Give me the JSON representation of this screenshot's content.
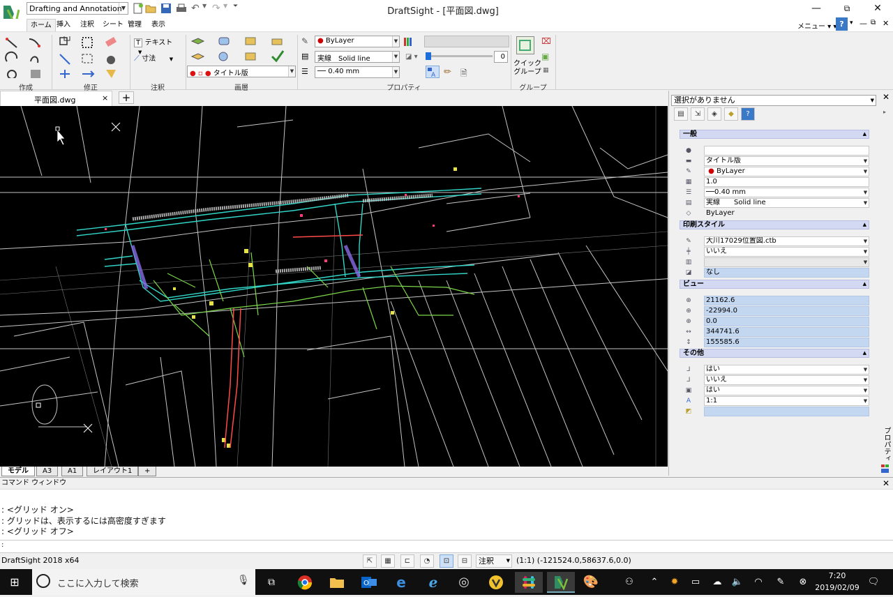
{
  "app": {
    "title": "DraftSight - [平面図.dwg]",
    "workspace": "Drafting and Annotation",
    "menu_label": "メニュー"
  },
  "menu_tabs": [
    "ホーム",
    "挿入",
    "注釈",
    "シート",
    "管理",
    "表示"
  ],
  "ribbon": {
    "groups": [
      "作成",
      "修正",
      "注釈",
      "画層",
      "プロパティ",
      "グループ"
    ],
    "text_label": "テキスト",
    "dim_label": "寸法",
    "layer_value": "タイトル版",
    "color_value": "ByLayer",
    "linetype_value": "実線　Solid line",
    "lineweight_value": "── 0.40 mm",
    "transparency_value": "0",
    "quick_group": "クイック\nグループ"
  },
  "doc_tab": {
    "name": "平面図.dwg",
    "close": "×",
    "add": "+"
  },
  "layout_tabs": [
    "モデル",
    "A3",
    "A1",
    "レイアウト1",
    "+"
  ],
  "properties": {
    "selection": "選択がありません",
    "sections": {
      "general": {
        "title": "一般",
        "rows": [
          "",
          "タイトル版",
          "ByLayer",
          "1.0",
          "──0.40 mm",
          "実線　　Solid line",
          "ByLayer"
        ]
      },
      "print": {
        "title": "印刷スタイル",
        "rows": [
          "大川17029位置図.ctb",
          "いいえ",
          "",
          "なし"
        ]
      },
      "view": {
        "title": "ビュー",
        "rows": [
          "21162.6",
          "-22994.0",
          "0.0",
          "344741.6",
          "155585.6"
        ]
      },
      "misc": {
        "title": "その他",
        "rows": [
          "はい",
          "いいえ",
          "はい",
          "1:1",
          ""
        ]
      }
    },
    "side_label": "プロパティ"
  },
  "command": {
    "title": "コマンド ウィンドウ",
    "lines": [
      ": <グリッド オン>",
      ": グリッドは、表示するには高密度すぎます",
      ": <グリッド オフ>"
    ],
    "prompt": ":"
  },
  "status": {
    "app_version": "DraftSight 2018 x64",
    "annotation": "注釈",
    "coords": "(1:1) (-121524.0,58637.6,0.0)"
  },
  "taskbar": {
    "search_placeholder": "ここに入力して検索",
    "time": "7:20",
    "date": "2019/02/09"
  },
  "colors": {
    "canvas": "#000000",
    "accent": "#1e6fd9",
    "selection": "#c3d7f1",
    "section": "#d3d9f2"
  }
}
